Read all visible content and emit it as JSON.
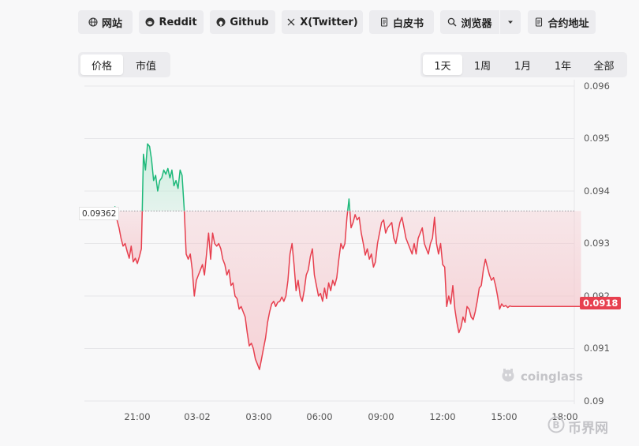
{
  "links": [
    {
      "label": "网站",
      "icon": "globe-icon"
    },
    {
      "label": "Reddit",
      "icon": "reddit-icon"
    },
    {
      "label": "Github",
      "icon": "github-icon"
    },
    {
      "label": "X(Twitter)",
      "icon": "x-icon"
    },
    {
      "label": "白皮书",
      "icon": "document-icon"
    },
    {
      "label": "浏览器",
      "icon": "search-icon"
    },
    {
      "label": "合约地址",
      "icon": "document-icon"
    }
  ],
  "metric_tabs": [
    {
      "label": "价格",
      "active": true
    },
    {
      "label": "市值",
      "active": false
    }
  ],
  "range_tabs": [
    {
      "label": "1天",
      "active": true
    },
    {
      "label": "1周",
      "active": false
    },
    {
      "label": "1月",
      "active": false
    },
    {
      "label": "1年",
      "active": false
    },
    {
      "label": "全部",
      "active": false
    }
  ],
  "colors": {
    "up": "#1db97a",
    "down": "#e7404f",
    "up_fill": "#bfead6",
    "down_fill": "#f5c6cb"
  },
  "watermark": {
    "brand": "coinglass",
    "site": "币界网"
  },
  "chart_data": {
    "type": "area",
    "reference_price": 0.09362,
    "reference_label": "0.09362",
    "current_price": 0.0918,
    "current_label": "0.0918",
    "ylim": [
      0.09,
      0.096
    ],
    "yticks": [
      "0.096",
      "0.095",
      "0.094",
      "0.093",
      "0.092",
      "0.091",
      "0.09"
    ],
    "xticks": [
      {
        "label": "21:00",
        "hour": 21
      },
      {
        "label": "03-02",
        "hour": 24
      },
      {
        "label": "03:00",
        "hour": 27
      },
      {
        "label": "06:00",
        "hour": 30
      },
      {
        "label": "09:00",
        "hour": 33
      },
      {
        "label": "12:00",
        "hour": 36
      },
      {
        "label": "15:00",
        "hour": 39
      },
      {
        "label": "18:00",
        "hour": 42
      }
    ],
    "x_hours": [
      18.5,
      18.6,
      18.7,
      18.8,
      18.9,
      19.0,
      19.1,
      19.2,
      19.3,
      19.4,
      19.5,
      19.6,
      19.7,
      19.8,
      19.9,
      20.0,
      20.1,
      20.2,
      20.3,
      20.4,
      20.5,
      20.6,
      20.7,
      20.8,
      20.9,
      21.0,
      21.1,
      21.2,
      21.3,
      21.4,
      21.5,
      21.6,
      21.7,
      21.8,
      21.9,
      22.0,
      22.1,
      22.2,
      22.3,
      22.4,
      22.5,
      22.6,
      22.7,
      22.8,
      22.9,
      23.0,
      23.1,
      23.2,
      23.3,
      23.4,
      23.5,
      23.6,
      23.7,
      23.8,
      23.9,
      24.0,
      24.1,
      24.2,
      24.3,
      24.4,
      24.5,
      24.6,
      24.7,
      24.8,
      24.9,
      25.0,
      25.1,
      25.2,
      25.3,
      25.4,
      25.5,
      25.6,
      25.7,
      25.8,
      25.9,
      26.0,
      26.1,
      26.2,
      26.3,
      26.4,
      26.5,
      26.6,
      26.7,
      26.8,
      26.9,
      27.0,
      27.1,
      27.2,
      27.3,
      27.4,
      27.5,
      27.6,
      27.7,
      27.8,
      27.9,
      28.0,
      28.1,
      28.2,
      28.3,
      28.4,
      28.5,
      28.6,
      28.7,
      28.8,
      28.9,
      29.0,
      29.1,
      29.2,
      29.3,
      29.4,
      29.5,
      29.6,
      29.7,
      29.8,
      29.9,
      30.0,
      30.1,
      30.2,
      30.3,
      30.4,
      30.5,
      30.6,
      30.7,
      30.8,
      30.9,
      31.0,
      31.1,
      31.2,
      31.3,
      31.4,
      31.5,
      31.6,
      31.7,
      31.8,
      31.9,
      32.0,
      32.1,
      32.2,
      32.3,
      32.4,
      32.5,
      32.6,
      32.7,
      32.8,
      32.9,
      33.0,
      33.1,
      33.2,
      33.3,
      33.4,
      33.5,
      33.6,
      33.7,
      33.8,
      33.9,
      34.0,
      34.1,
      34.2,
      34.3,
      34.4,
      34.5,
      34.6,
      34.7,
      34.8,
      34.9,
      35.0,
      35.1,
      35.2,
      35.3,
      35.4,
      35.5,
      35.6,
      35.7,
      35.8,
      35.9,
      36.0,
      36.1,
      36.2,
      36.3,
      36.4,
      36.5,
      36.6,
      36.7,
      36.8,
      36.9,
      37.0,
      37.1,
      37.2,
      37.3,
      37.4,
      37.5,
      37.6,
      37.7,
      37.8,
      37.9,
      38.0,
      38.1,
      38.2,
      38.3,
      38.4,
      38.5,
      38.6,
      38.7,
      38.8,
      38.9,
      39.0,
      39.1,
      39.2,
      39.3,
      39.4,
      39.5,
      39.6,
      39.7,
      39.8,
      39.9,
      40.0,
      40.1,
      40.2,
      40.3,
      40.4,
      40.5,
      40.6,
      40.7,
      40.8,
      40.9,
      41.0,
      41.1,
      41.2,
      41.3,
      41.4,
      41.5,
      41.6,
      41.7,
      41.8,
      41.9,
      42.0,
      42.1,
      42.2,
      42.3
    ],
    "y_price": [
      0.09365,
      0.09368,
      0.0936,
      0.09352,
      0.09358,
      0.09364,
      0.09352,
      0.09362,
      0.0937,
      0.09345,
      0.0933,
      0.0931,
      0.09295,
      0.093,
      0.09285,
      0.09272,
      0.09295,
      0.09265,
      0.09272,
      0.09262,
      0.09275,
      0.0929,
      0.0947,
      0.0944,
      0.0949,
      0.09485,
      0.0946,
      0.0942,
      0.0943,
      0.094,
      0.0942,
      0.09425,
      0.0944,
      0.09432,
      0.09443,
      0.09425,
      0.0944,
      0.0941,
      0.0942,
      0.09405,
      0.0944,
      0.0943,
      0.09368,
      0.0928,
      0.0927,
      0.0928,
      0.0925,
      0.092,
      0.0923,
      0.0924,
      0.0925,
      0.0926,
      0.0924,
      0.0928,
      0.0932,
      0.0927,
      0.0932,
      0.093,
      0.09295,
      0.093,
      0.0929,
      0.0927,
      0.0926,
      0.0924,
      0.0925,
      0.0922,
      0.09225,
      0.092,
      0.09195,
      0.09175,
      0.0918,
      0.0917,
      0.0916,
      0.0913,
      0.09105,
      0.0911,
      0.091,
      0.0908,
      0.0907,
      0.0906,
      0.0908,
      0.091,
      0.0912,
      0.0915,
      0.0917,
      0.09185,
      0.0919,
      0.0918,
      0.09188,
      0.0919,
      0.09198,
      0.0919,
      0.092,
      0.0923,
      0.0928,
      0.093,
      0.0926,
      0.0921,
      0.0923,
      0.092,
      0.0919,
      0.0921,
      0.0924,
      0.0925,
      0.09275,
      0.0929,
      0.0924,
      0.0922,
      0.092,
      0.09205,
      0.0919,
      0.09215,
      0.09195,
      0.09225,
      0.0921,
      0.0923,
      0.0922,
      0.09235,
      0.0927,
      0.093,
      0.0929,
      0.093,
      0.0935,
      0.09385,
      0.0933,
      0.0934,
      0.09355,
      0.09345,
      0.0935,
      0.0932,
      0.093,
      0.09278,
      0.0929,
      0.0927,
      0.0928,
      0.09255,
      0.09265,
      0.093,
      0.0932,
      0.0934,
      0.09345,
      0.0932,
      0.0933,
      0.09335,
      0.0934,
      0.0931,
      0.093,
      0.0932,
      0.0934,
      0.0935,
      0.0933,
      0.0931,
      0.093,
      0.0929,
      0.0928,
      0.093,
      0.0928,
      0.0931,
      0.0932,
      0.0933,
      0.093,
      0.0929,
      0.0928,
      0.093,
      0.0931,
      0.0935,
      0.093,
      0.0928,
      0.093,
      0.0926,
      0.09255,
      0.0918,
      0.092,
      0.09185,
      0.0922,
      0.09175,
      0.0915,
      0.0913,
      0.0914,
      0.0916,
      0.0915,
      0.0918,
      0.09175,
      0.0916,
      0.09155,
      0.0917,
      0.0919,
      0.09215,
      0.0922,
      0.0925,
      0.0927,
      0.09255,
      0.0924,
      0.0923,
      0.09235,
      0.0922,
      0.092,
      0.09175,
      0.09185,
      0.0918,
      0.09182,
      0.09178,
      0.09181,
      0.0918,
      0.0918,
      0.0918,
      0.0918,
      0.0918,
      0.0918,
      0.0918,
      0.0918,
      0.0918,
      0.0918,
      0.0918,
      0.0918,
      0.0918,
      0.0918,
      0.0918,
      0.0918,
      0.0918,
      0.0918,
      0.0918,
      0.0918,
      0.0918,
      0.0918,
      0.0918,
      0.0918,
      0.0918,
      0.0918,
      0.0918,
      0.0918,
      0.0918,
      0.0918,
      0.0918,
      0.0918,
      0.0918,
      0.0918,
      0.0918,
      0.0918
    ]
  }
}
